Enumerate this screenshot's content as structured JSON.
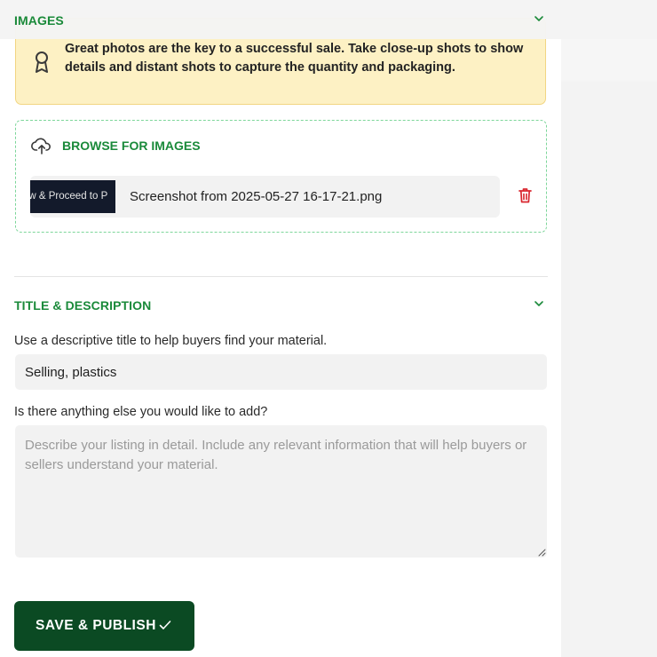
{
  "images_section": {
    "title": "IMAGES",
    "info_text": "Great photos are the key to a successful sale. Take close-up shots to show details and distant shots to capture the quantity and packaging.",
    "icon": "award-icon",
    "browse_label": "BROWSE FOR IMAGES",
    "files": [
      {
        "thumbnail_text": "ow & Proceed to P",
        "name": "Screenshot from 2025-05-27 16-17-21.png"
      }
    ]
  },
  "title_section": {
    "title": "TITLE & DESCRIPTION",
    "title_label": "Use a descriptive title to help buyers find your material.",
    "title_value": "Selling, plastics",
    "details_label": "Is there anything else you would like to add?",
    "details_placeholder": "Describe your listing in detail. Include any relevant information that will help buyers or sellers understand your material.",
    "details_value": ""
  },
  "actions": {
    "publish_label": "SAVE & PUBLISH"
  },
  "colors": {
    "accent_green": "#1a8a3a",
    "button_dark_green": "#0b4a23",
    "warning_bg": "#fdf1c4",
    "delete_red": "#d9262e"
  }
}
